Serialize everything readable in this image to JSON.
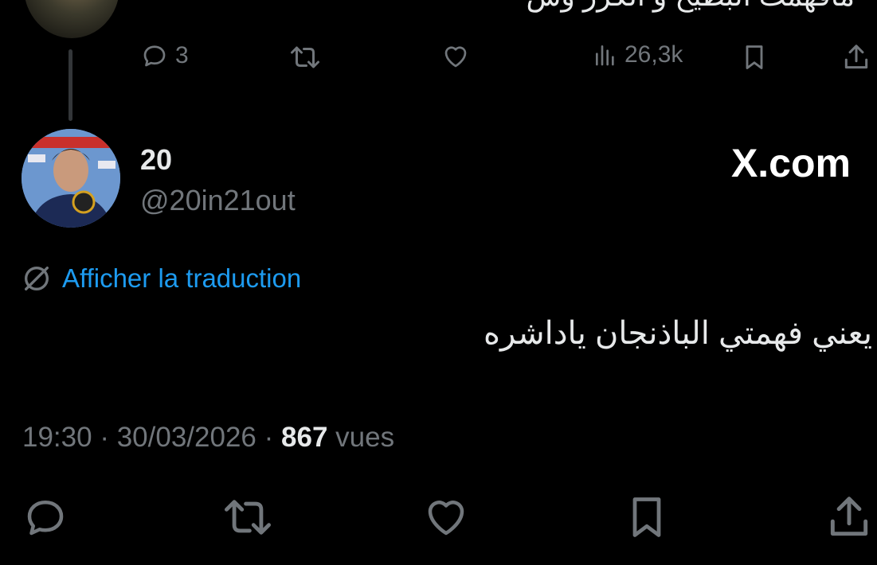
{
  "previous_tweet": {
    "text": "مافهمت البطيخ و الكرز وش",
    "actions": {
      "reply_count": "3",
      "views_count": "26,3k"
    }
  },
  "tweet": {
    "display_name": "20",
    "handle": "@20in21out",
    "brand": "X.com",
    "translate_label": "Afficher la traduction",
    "text": "يعني فهمتي الباذنجان ياداشره",
    "time": "19:30",
    "date": "30/03/2026",
    "views_count": "867",
    "views_label": "vues",
    "separator": "·"
  },
  "colors": {
    "background": "#000000",
    "text": "#e7e9ea",
    "secondary": "#71767b",
    "link": "#1d9bf0"
  },
  "icons": [
    "reply-icon",
    "retweet-icon",
    "like-icon",
    "views-icon",
    "bookmark-icon",
    "share-icon",
    "translate-icon"
  ]
}
